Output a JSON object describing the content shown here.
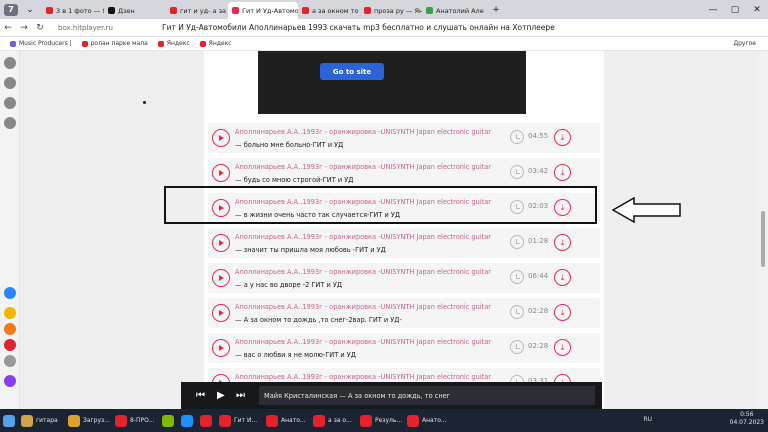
{
  "browser": {
    "tab_count": "7",
    "tabs": [
      {
        "title": "3 в 1 фото — Янде",
        "color": "#e2222c"
      },
      {
        "title": "Дзен",
        "color": "#111111"
      },
      {
        "title": "гит и уд- а за окно",
        "color": "#e2222c"
      },
      {
        "title": "Гит И Уд-Автомоб",
        "color": "#e8294f",
        "active": true
      },
      {
        "title": "а за окном то дож",
        "color": "#e2222c"
      },
      {
        "title": "проза ру — Яндекс",
        "color": "#e2222c"
      },
      {
        "title": "Анатолий Алексан",
        "color": "#3aa04a"
      }
    ],
    "url_host": "box.hitplayer.ru",
    "page_title": "Гит И Уд-Автомобили Аполлинарьев 1993 скачать mp3 бесплатно и слушать онлайн на Хотплеере",
    "bookmarks": [
      "Music Producers |",
      "ролан парке мала",
      "Яндекс",
      "Яндекс"
    ],
    "bookmarks_other": "Другое"
  },
  "page": {
    "goto_label": "Go to site",
    "tracks": [
      {
        "artist": "Аполлинарьев А.А..1993г - оранжировка -UNISYNTH Japan electronic guitar",
        "song": "— больно мне больно-ГИТ и УД",
        "duration": "04:55"
      },
      {
        "artist": "Аполлинарьев А.А..1993г - оранжировка -UNISYNTH Japan electronic guitar",
        "song": "— будь со мною строгой-ГИТ и УД",
        "duration": "03:42"
      },
      {
        "artist": "Аполлинарьев А.А..1993г - оранжировка -UNISYNTH Japan electronic guitar",
        "song": "— в жизни очень часто так случается-ГИТ и УД",
        "duration": "02:03"
      },
      {
        "artist": "Аполлинарьев А.А..1993г - оранжировка -UNISYNTH Japan electronic guitar",
        "song": "— значит ты пришла моя любовь -ГИТ и УД",
        "duration": "01:28"
      },
      {
        "artist": "Аполлинарьев А.А..1993г - оранжировка -UNISYNTH Japan electronic guitar",
        "song": "— а у нас во дворе -2 ГИТ и УД",
        "duration": "06:44"
      },
      {
        "artist": "Аполлинарьев А.А..1993г - оранжировка -UNISYNTH Japan electronic guitar",
        "song": "— А за окном то дождь ,то снег-2вар. ГИТ и УД-",
        "duration": "02:28"
      },
      {
        "artist": "Аполлинарьев А.А..1993г - оранжировка -UNISYNTH Japan electronic guitar",
        "song": "— вас о любви я не молю-ГИТ и УД",
        "duration": "02:28"
      },
      {
        "artist": "Аполлинарьев А.А..1993г - оранжировка -UNISYNTH Japan electronic guitar",
        "song": "",
        "duration": "03:31"
      }
    ]
  },
  "player": {
    "now_playing": "Майя Кристалинская — А за окном то дождь, то снег"
  },
  "taskbar": {
    "items": [
      "гитара",
      "Загруз...",
      "8-ПРО...",
      "",
      "",
      "",
      "Гит И...",
      "Анато...",
      "а за о...",
      "Резуль...",
      "Анато..."
    ],
    "lang": "RU",
    "time": "0:56",
    "date": "04.07.2023"
  }
}
